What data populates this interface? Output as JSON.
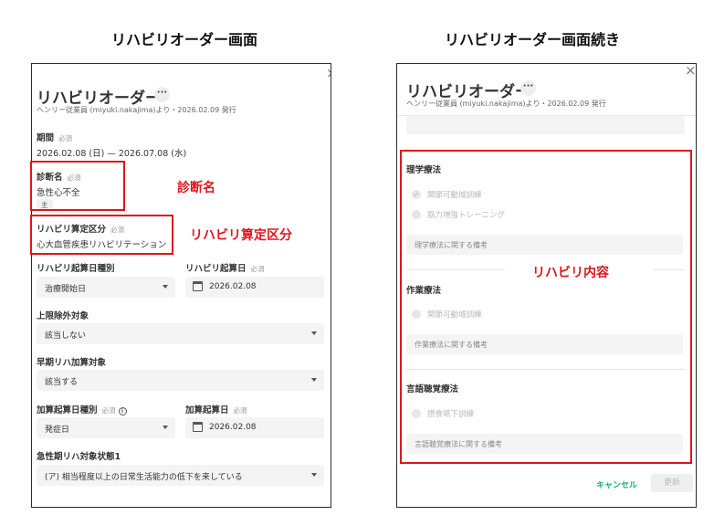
{
  "captions": {
    "left": "リハビリオーダー画面",
    "right": "リハビリオーダー画面続き"
  },
  "header": {
    "title": "リハビリオーダー",
    "more_glyph": "···",
    "close_glyph": "×",
    "subtitle": "ヘンリー従業員 (miyuki.nakajima)より・2026.02.09 発行"
  },
  "left": {
    "period": {
      "label": "期間",
      "required": "必須",
      "value": "2026.02.08 (日) — 2026.07.08 (水)"
    },
    "diagnosis": {
      "label": "診断名",
      "required": "必須",
      "value": "急性心不全",
      "chip": "主"
    },
    "category": {
      "label": "リハビリ算定区分",
      "required": "必須",
      "value": "心大血管疾患リハビリテーション"
    },
    "start_type": {
      "label": "リハビリ起算日種別",
      "value": "治療開始日"
    },
    "start_date": {
      "label": "リハビリ起算日",
      "required": "必須",
      "value": "2026.02.08"
    },
    "limit_exclusion": {
      "label": "上限除外対象",
      "value": "該当しない"
    },
    "early_addition": {
      "label": "早期リハ加算対象",
      "value": "該当する"
    },
    "addition_type": {
      "label": "加算起算日種別",
      "required": "必須",
      "info_glyph": "i",
      "value": "発症日"
    },
    "addition_date": {
      "label": "加算起算日",
      "required": "必須",
      "value": "2026.02.08"
    },
    "acute_state": {
      "label": "急性期リハ対象状態1",
      "value": "(ア) 相当程度以上の日常生活能力の低下を来している"
    }
  },
  "annotations": {
    "diagnosis": "診断名",
    "category": "リハビリ算定区分",
    "content": "リハビリ内容",
    "color": "#e1141c"
  },
  "right": {
    "pt": {
      "title": "理学療法",
      "options": [
        "関節可動域訓練",
        "筋力増強トレーニング"
      ],
      "note_placeholder": "理学療法に関する備考"
    },
    "ot": {
      "title": "作業療法",
      "options": [
        "関節可動域訓練"
      ],
      "note_placeholder": "作業療法に関する備考"
    },
    "st": {
      "title": "言語聴覚療法",
      "options": [
        "摂食嚥下訓練"
      ],
      "note_placeholder": "言語聴覚療法に関する備考"
    },
    "footer": {
      "cancel": "キャンセル",
      "update": "更新",
      "accent": "#10b47a"
    }
  }
}
